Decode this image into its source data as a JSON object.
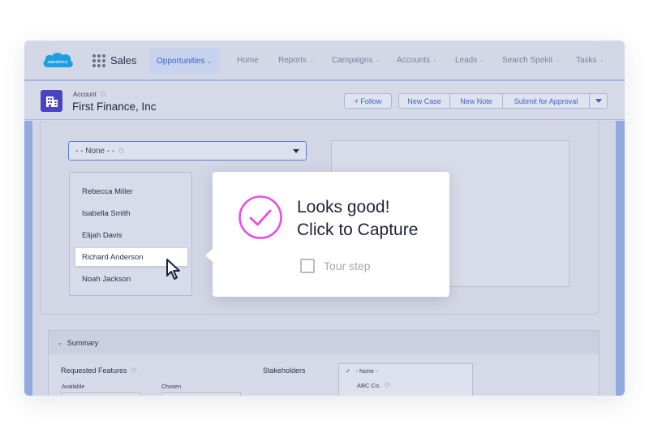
{
  "nav": {
    "logo_text": "salesforce",
    "app_name": "Sales",
    "items": [
      {
        "label": "Opportunities",
        "active": true
      },
      {
        "label": "Home"
      },
      {
        "label": "Reports"
      },
      {
        "label": "Campaigns"
      },
      {
        "label": "Accounts"
      },
      {
        "label": "Leads"
      },
      {
        "label": "Search Spekit"
      },
      {
        "label": "Tasks"
      }
    ]
  },
  "header": {
    "object_type": "Account",
    "record_name": "First Finance, Inc",
    "buttons": {
      "follow": "+ Follow",
      "new_case": "New Case",
      "new_note": "New Note",
      "submit": "Submit for Approval"
    }
  },
  "picklist": {
    "value": "- - None - -"
  },
  "contacts": [
    "Rebecca Miller",
    "Isabella Smith",
    "Elijah Davis",
    "Richard Anderson",
    "Noah Jackson"
  ],
  "popup": {
    "title_line1": "Looks good!",
    "title_line2": "Click to Capture",
    "checkbox_label": "Tour step"
  },
  "summary": {
    "title": "Summary",
    "requested_features": "Requested Features",
    "available": "Available",
    "chosen": "Chosen",
    "stakeholders": "Stakeholders",
    "dropdown": [
      "- None -",
      "ABC Co."
    ]
  },
  "colors": {
    "accent": "#3d64c4",
    "account_icon": "#4a44c0",
    "check": "#e94ee3",
    "sidebar": "#93a9e0"
  }
}
